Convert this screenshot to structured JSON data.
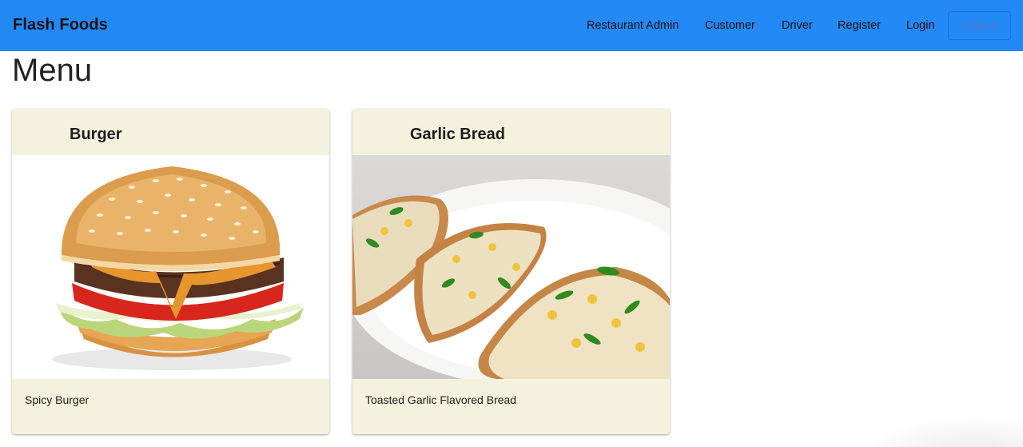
{
  "navbar": {
    "brand": "Flash Foods",
    "links": [
      "Restaurant Admin",
      "Customer",
      "Driver",
      "Register",
      "Login"
    ],
    "logout_label": "Logout"
  },
  "page": {
    "title": "Menu"
  },
  "menu_items": [
    {
      "name": "Burger",
      "description": "Spicy Burger"
    },
    {
      "name": "Garlic Bread",
      "description": "Toasted Garlic Flavored Bread"
    }
  ],
  "colors": {
    "navbar": "#2389f7",
    "card_background": "#f4f2dc",
    "logout_border": "#1b73d6"
  }
}
